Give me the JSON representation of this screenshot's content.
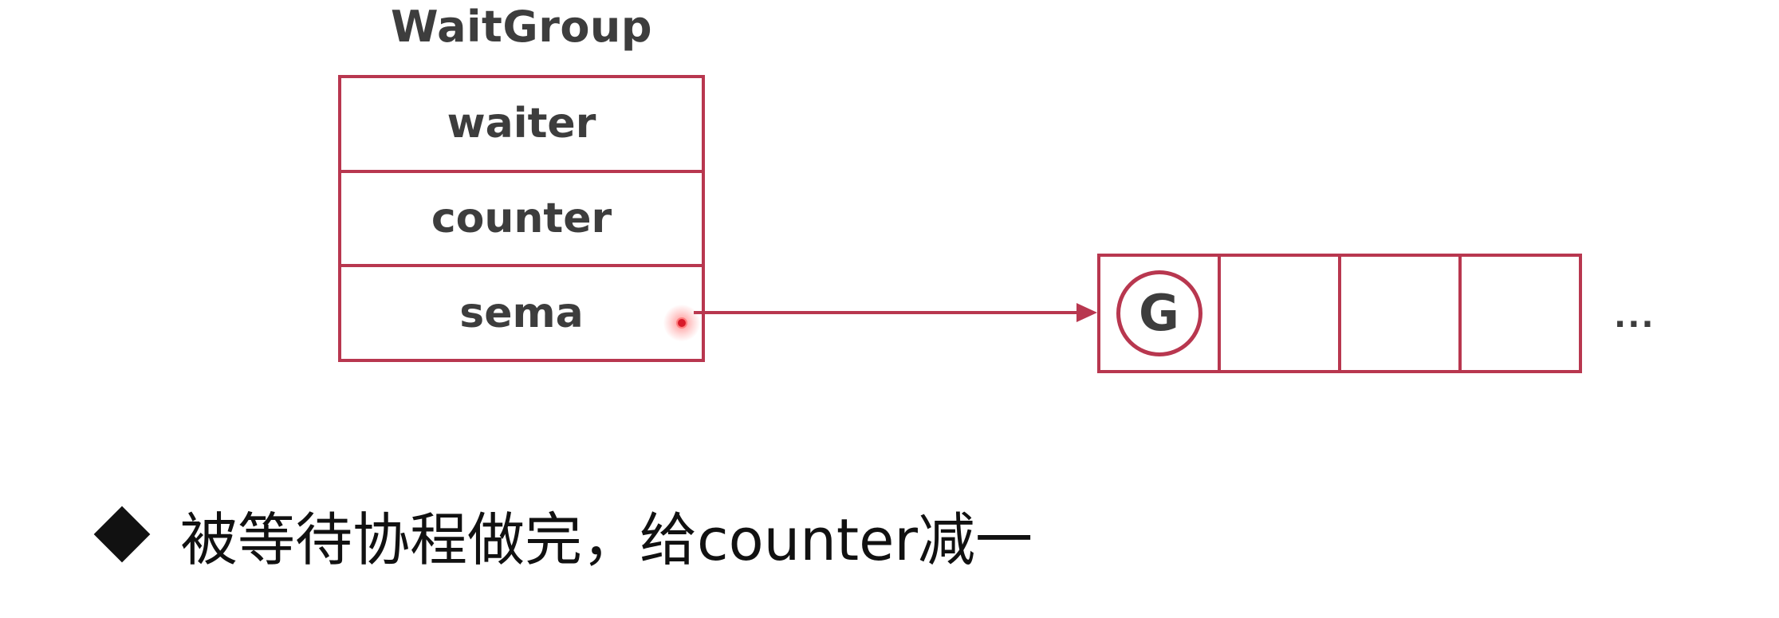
{
  "struct": {
    "title": "WaitGroup",
    "fields": [
      "waiter",
      "counter",
      "sema"
    ]
  },
  "queue": {
    "first_cell_label": "G",
    "cell_count": 4,
    "ellipsis": "..."
  },
  "bullet": {
    "text": "被等待协程做完，给counter减一"
  },
  "colors": {
    "border": "#b8374f",
    "text": "#3d3d3d",
    "pointer_dot": "#d81b2a"
  }
}
